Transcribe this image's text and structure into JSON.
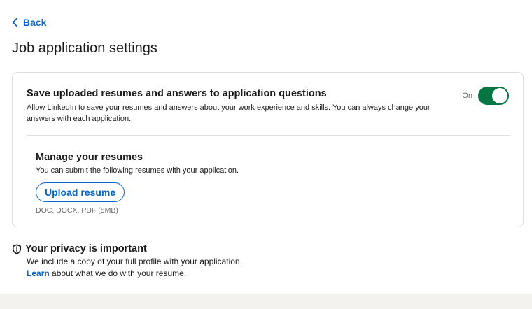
{
  "nav": {
    "back_label": "Back"
  },
  "page": {
    "title": "Job application settings"
  },
  "save_setting": {
    "heading": "Save uploaded resumes and answers to application questions",
    "description": "Allow LinkedIn to save your resumes and answers about your work experience and skills. You can always change your answers with each application.",
    "toggle_state": "On",
    "toggle_on": true
  },
  "resumes": {
    "heading": "Manage your resumes",
    "description": "You can submit the following resumes with your application.",
    "upload_label": "Upload resume",
    "file_types": "DOC, DOCX, PDF (5MB)"
  },
  "privacy": {
    "heading": "Your privacy is important",
    "line1": "We include a copy of your full profile with your application.",
    "learn_link": "Learn",
    "line2_rest": " about what we do with your resume."
  },
  "icons": {
    "back": "chevron-left-icon",
    "privacy": "shield-icon"
  },
  "colors": {
    "accent": "#0a66c2",
    "toggle_on": "#057642"
  }
}
